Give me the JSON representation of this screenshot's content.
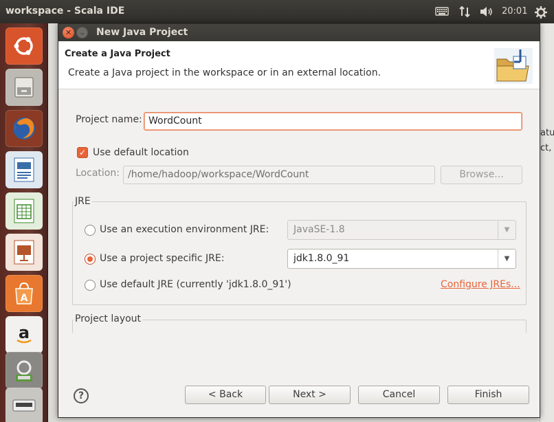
{
  "top_panel": {
    "app_title": "workspace - Scala IDE",
    "clock": "20:01",
    "icons": [
      "keyboard-icon",
      "network-icon",
      "volume-icon",
      "gear-icon"
    ]
  },
  "launcher": {
    "items": [
      "ubuntu-dash-icon",
      "files-icon",
      "firefox-icon",
      "writer-icon",
      "calc-icon",
      "impress-icon",
      "software-center-icon",
      "amazon-icon",
      "system-settings-icon"
    ]
  },
  "background": {
    "right_text_1": "atu",
    "right_text_2": "ct,"
  },
  "dialog": {
    "title": "New Java Project",
    "header_title": "Create a Java Project",
    "header_desc": "Create a Java project in the workspace or in an external location.",
    "project_name_label": "Project name:",
    "project_name_value": "WordCount",
    "use_default_location_label": "Use default location",
    "use_default_location_checked": true,
    "location_label": "Location:",
    "location_value": "/home/hadoop/workspace/WordCount",
    "browse_label": "Browse...",
    "jre_group_title": "JRE",
    "jre_options": [
      {
        "label": "Use an execution environment JRE:",
        "selected": false,
        "combo": "JavaSE-1.8"
      },
      {
        "label": "Use a project specific JRE:",
        "selected": true,
        "combo": "jdk1.8.0_91"
      },
      {
        "label": "Use default JRE (currently 'jdk1.8.0_91')",
        "selected": false
      }
    ],
    "configure_jres_link": "Configure JREs...",
    "project_layout_title": "Project layout",
    "buttons": {
      "back": "< Back",
      "next": "Next >",
      "cancel": "Cancel",
      "finish": "Finish"
    }
  },
  "colors": {
    "accent": "#e9643a",
    "panel": "#3c3b37",
    "dialog_bg": "#f2f1f0"
  }
}
